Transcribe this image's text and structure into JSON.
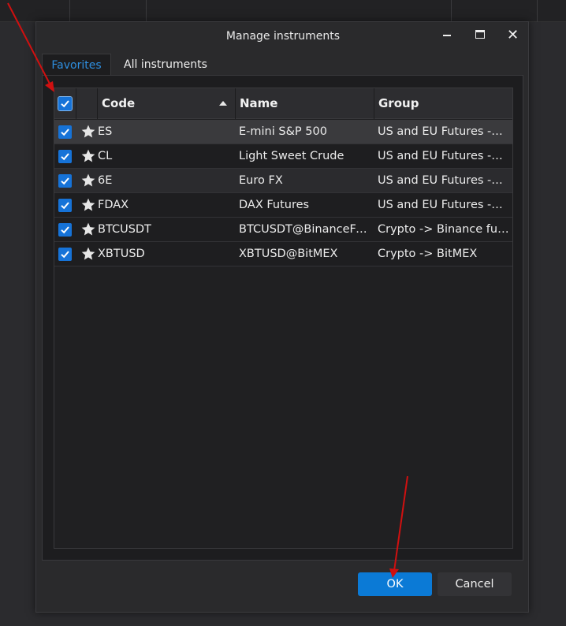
{
  "dialog": {
    "title": "Manage instruments",
    "controls": {
      "minimize_icon": "minimize-icon",
      "maximize_icon": "maximize-icon",
      "close_icon": "close-icon"
    }
  },
  "tabs": [
    {
      "label": "Favorites",
      "active": true
    },
    {
      "label": "All instruments",
      "active": false
    }
  ],
  "table": {
    "columns": {
      "code": "Code",
      "name": "Name",
      "group": "Group"
    },
    "sort": {
      "column": "code",
      "direction": "ascending"
    },
    "rows": [
      {
        "code": "ES",
        "name": "E-mini S&P 500",
        "group": "US and EU Futures -> E...",
        "checked": true,
        "favorite": true
      },
      {
        "code": "CL",
        "name": "Light Sweet Crude",
        "group": "US and EU Futures -> E...",
        "checked": true,
        "favorite": true
      },
      {
        "code": "6E",
        "name": "Euro FX",
        "group": "US and EU Futures -> FX",
        "checked": true,
        "favorite": true
      },
      {
        "code": "FDAX",
        "name": "DAX Futures",
        "group": "US and EU Futures -> E...",
        "checked": true,
        "favorite": true
      },
      {
        "code": "BTCUSDT",
        "name": "BTCUSDT@BinanceFutu...",
        "group": "Crypto -> Binance futu...",
        "checked": true,
        "favorite": true
      },
      {
        "code": "XBTUSD",
        "name": "XBTUSD@BitMEX",
        "group": "Crypto -> BitMEX",
        "checked": true,
        "favorite": true
      }
    ]
  },
  "buttons": {
    "ok": "OK",
    "cancel": "Cancel"
  },
  "colors": {
    "accent": "#0b7ad6",
    "active_tab_text": "#2e8fe0",
    "checkbox": "#1673d8",
    "annotation_arrow": "#d01010"
  }
}
